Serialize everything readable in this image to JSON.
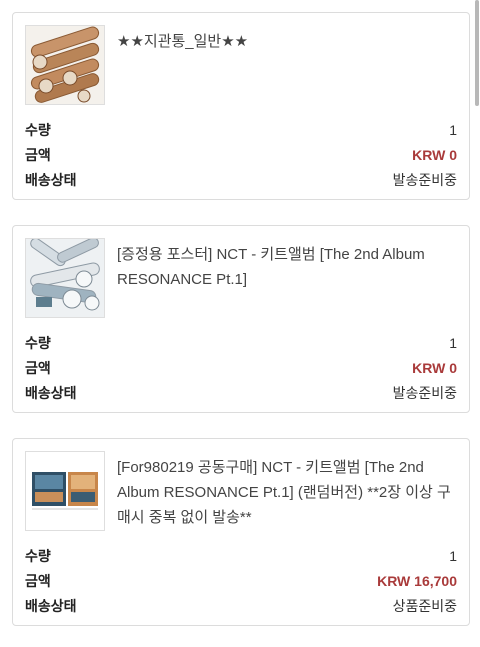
{
  "orders": [
    {
      "product_name": "★★지관통_일반★★",
      "image_icon": "paper-tubes-image",
      "rows": [
        {
          "label": "수량",
          "value": "1"
        },
        {
          "label": "금액",
          "value": "KRW 0"
        },
        {
          "label": "배송상태",
          "value": "발송준비중"
        }
      ]
    },
    {
      "product_name": "[증정용 포스터] NCT - 키트앨범 [The 2nd Album RESONANCE Pt.1]",
      "image_icon": "rolled-posters-image",
      "rows": [
        {
          "label": "수량",
          "value": "1"
        },
        {
          "label": "금액",
          "value": "KRW 0"
        },
        {
          "label": "배송상태",
          "value": "발송준비중"
        }
      ]
    },
    {
      "product_name": "[For980219 공동구매] NCT - 키트앨범 [The 2nd Album RESONANCE Pt.1] (랜덤버전) **2장 이상 구매시 중복 없이 발송**",
      "image_icon": "album-boxes-image",
      "rows": [
        {
          "label": "수량",
          "value": "1"
        },
        {
          "label": "금액",
          "value": "KRW 16,700"
        },
        {
          "label": "배송상태",
          "value": "상품준비중"
        }
      ]
    }
  ],
  "colors": {
    "price": "#a93a3a",
    "border": "#dcdcdc"
  }
}
